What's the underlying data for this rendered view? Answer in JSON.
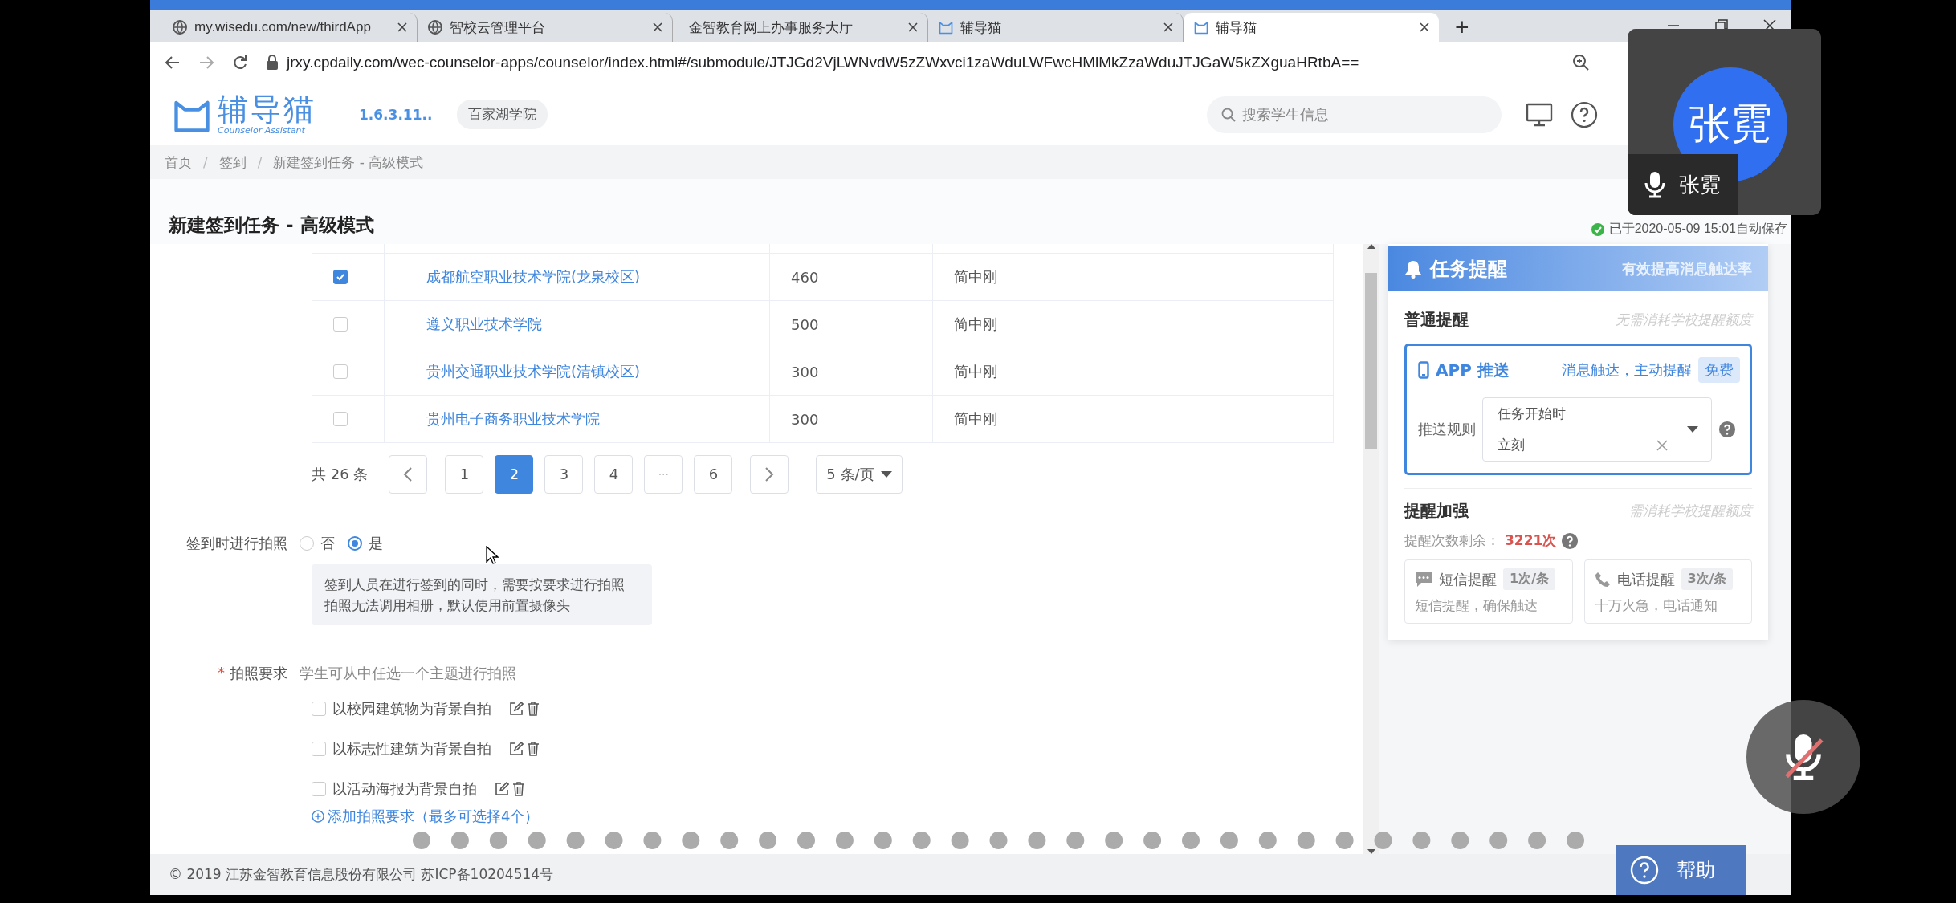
{
  "browser": {
    "tabs": [
      {
        "title": "my.wisedu.com/new/thirdApp",
        "kind": "globe",
        "selected": false
      },
      {
        "title": "智校云管理平台",
        "kind": "globe",
        "selected": false
      },
      {
        "title": "金智教育网上办事服务大厅",
        "kind": "blank",
        "selected": false
      },
      {
        "title": "辅导猫",
        "kind": "app",
        "selected": false
      },
      {
        "title": "辅导猫",
        "kind": "app",
        "selected": true
      }
    ],
    "new_tab": "+",
    "url": "jrxy.cpdaily.com/wec-counselor-apps/counselor/index.html#/submodule/JTJGd2VjLWNvdW5zZWxvci1zaWduLWFwcHMlMkZzaWduJTJGaW5kZXguaHRtbA=="
  },
  "header": {
    "logo": "辅导猫",
    "logo_sub": "Counselor Assistant",
    "version": "1.6.3.11..",
    "school": "百家湖学院",
    "search": {
      "placeholder": "搜索学生信息"
    }
  },
  "breadcrumb": {
    "separator": "/",
    "items": [
      "首页",
      "签到",
      "新建签到任务 - 高级模式"
    ]
  },
  "page": {
    "title": "新建签到任务 - 高级模式",
    "save_status": "已于2020-05-09 15:01自动保存"
  },
  "table": {
    "rows": [
      {
        "checked": true,
        "name": "成都航空职业技术学院(龙泉校区)",
        "count": "460",
        "owner": "简中刚"
      },
      {
        "checked": false,
        "name": "遵义职业技术学院",
        "count": "500",
        "owner": "简中刚"
      },
      {
        "checked": false,
        "name": "贵州交通职业技术学院(清镇校区)",
        "count": "300",
        "owner": "简中刚"
      },
      {
        "checked": false,
        "name": "贵州电子商务职业技术学院",
        "count": "300",
        "owner": "简中刚"
      }
    ]
  },
  "pagination": {
    "total": "共 26 条",
    "pages": [
      {
        "kind": "page",
        "label": "1",
        "selected": false
      },
      {
        "kind": "page",
        "label": "2",
        "selected": true
      },
      {
        "kind": "page",
        "label": "3",
        "selected": false
      },
      {
        "kind": "page",
        "label": "4",
        "selected": false
      },
      {
        "kind": "ellipsis",
        "label": "···",
        "selected": false
      },
      {
        "kind": "page",
        "label": "6",
        "selected": false
      }
    ],
    "page_size": "5 条/页"
  },
  "photo": {
    "label": "签到时进行拍照",
    "options": [
      {
        "label": "否",
        "selected": false
      },
      {
        "label": "是",
        "selected": true
      }
    ],
    "hint_lines": [
      "签到人员在进行签到的同时，需要按要求进行拍照",
      "拍照无法调用相册，默认使用前置摄像头"
    ]
  },
  "requirements": {
    "required_mark": "*",
    "label": "拍照要求",
    "hint": "学生可从中任选一个主题进行拍照",
    "items": [
      {
        "label": "以校园建筑物为背景自拍",
        "checked": false
      },
      {
        "label": "以标志性建筑为背景自拍",
        "checked": false
      },
      {
        "label": "以活动海报为背景自拍",
        "checked": false
      }
    ],
    "add_link": "添加拍照要求（最多可选择4个）"
  },
  "footer": "© 2019 江苏金智教育信息股份有限公司 苏ICP备10204514号",
  "reminder": {
    "title": "任务提醒",
    "tagline": "有效提高消息触达率",
    "normal": {
      "title": "普通提醒",
      "note": "无需消耗学校提醒额度",
      "push": {
        "title": "APP 推送",
        "desc": "消息触达，主动提醒",
        "badge": "免费",
        "rule_label": "推送规则",
        "rule_lines": [
          "任务开始时",
          "立刻"
        ]
      }
    },
    "enhance": {
      "title": "提醒加强",
      "note": "需消耗学校提醒额度",
      "remaining_label": "提醒次数剩余：",
      "remaining_count": "3221次",
      "cards": [
        {
          "kind": "sms",
          "title": "短信提醒",
          "price": "1次/条",
          "desc": "短信提醒，确保触达"
        },
        {
          "kind": "phone",
          "title": "电话提醒",
          "price": "3次/条",
          "desc": "十万火急，电话通知"
        }
      ]
    }
  },
  "call": {
    "avatar": "张霓",
    "name": "张霓",
    "muted": true
  },
  "help": "帮助"
}
